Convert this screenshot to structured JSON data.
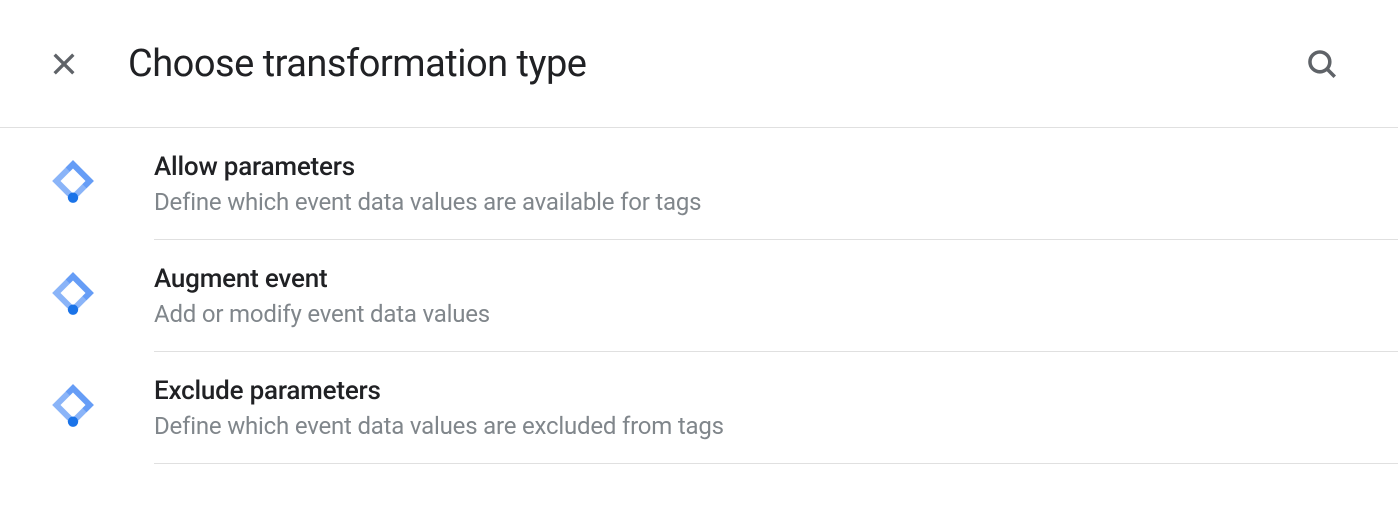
{
  "header": {
    "title": "Choose transformation type"
  },
  "items": [
    {
      "title": "Allow parameters",
      "description": "Define which event data values are available for tags"
    },
    {
      "title": "Augment event",
      "description": "Add or modify event data values"
    },
    {
      "title": "Exclude parameters",
      "description": "Define which event data values are excluded from tags"
    }
  ]
}
